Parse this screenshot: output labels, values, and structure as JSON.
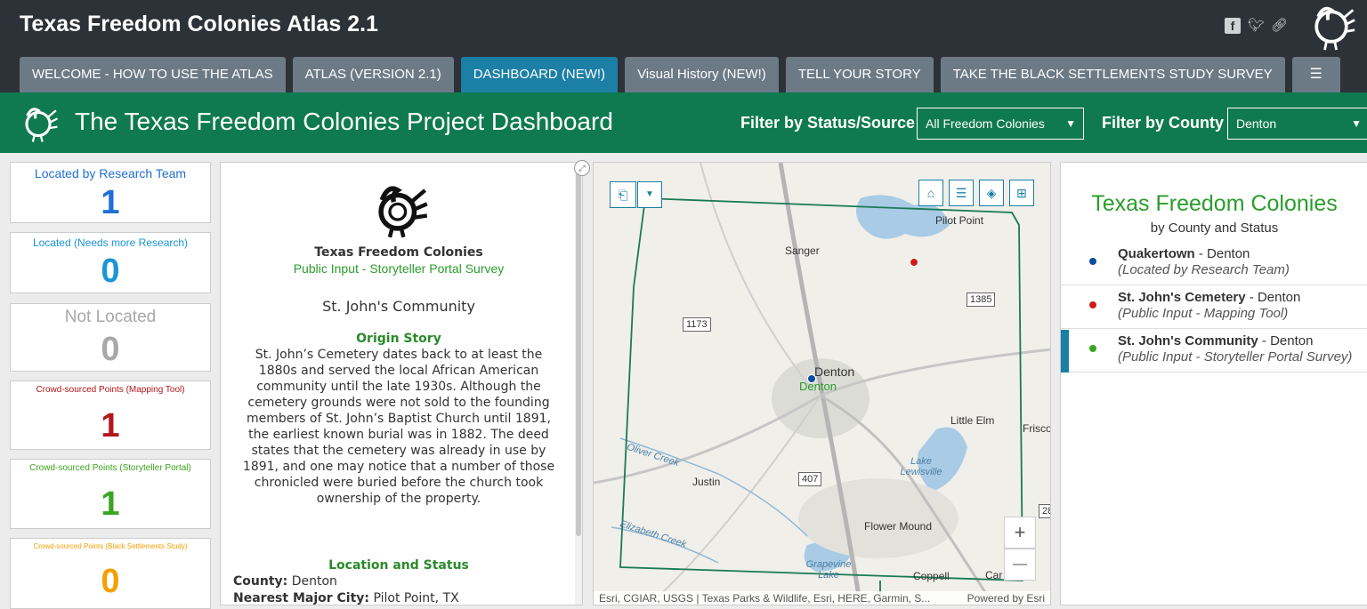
{
  "app": {
    "title": "Texas Freedom Colonies Atlas 2.1",
    "social_icons": [
      "facebook-icon",
      "twitter-icon",
      "link-icon"
    ]
  },
  "tabs": [
    {
      "label": "WELCOME - HOW TO USE THE ATLAS",
      "active": false
    },
    {
      "label": "ATLAS (VERSION 2.1)",
      "active": false
    },
    {
      "label": "DASHBOARD (NEW!)",
      "active": true
    },
    {
      "label": "Visual History (NEW!)",
      "active": false
    },
    {
      "label": "TELL YOUR STORY",
      "active": false
    },
    {
      "label": "TAKE THE BLACK SETTLEMENTS STUDY SURVEY",
      "active": false
    }
  ],
  "dashboard": {
    "title": "The Texas Freedom Colonies Project Dashboard",
    "filter_status_label": "Filter by Status/Source",
    "filter_status_value": "All Freedom Colonies",
    "filter_county_label": "Filter by County",
    "filter_county_value": "Denton"
  },
  "indicators": [
    {
      "label": "Located by Research Team",
      "value": "1",
      "color": "#1f6fd6"
    },
    {
      "label": "Located (Needs more Research)",
      "value": "0",
      "color": "#1b95d6"
    },
    {
      "label": "Not Located",
      "value": "0",
      "color": "#a8a8a8"
    },
    {
      "label": "Crowd-sourced Points (Mapping Tool)",
      "value": "1",
      "color": "#b3161b"
    },
    {
      "label": "Crowd-sourced Points (Storyteller Portal)",
      "value": "1",
      "color": "#3aa51e"
    },
    {
      "label": "Crowd-sourced Points (Black Settlements Study)",
      "value": "0",
      "color": "#f59f00"
    }
  ],
  "survey": {
    "title": "Texas Freedom Colonies",
    "subtitle": "Public Input - Storyteller Portal Survey",
    "community": "St. John's Community",
    "origin_heading": "Origin Story",
    "origin_text": "St. John’s Cemetery dates back to at least the 1880s and served the local African American community until the late 1930s. Although the cemetery grounds were not sold to the founding members of St. John’s Baptist Church until 1891, the earliest known burial was in 1882. The deed states that the cemetery was already in use by 1891, and one may notice that a number of those chronicled were buried before the church took ownership of the property.",
    "location_heading": "Location and Status",
    "county_key": "County:",
    "county_value": "Denton",
    "city_key": "Nearest Major City:",
    "city_value": "Pilot Point, TX"
  },
  "map": {
    "labels": {
      "pilot_point": "Pilot Point",
      "sanger": "Sanger",
      "denton": "Denton",
      "denton_green": "Denton",
      "little_elm": "Little Elm",
      "frisco": "Frisco",
      "justin": "Justin",
      "flower_mound": "Flower Mound",
      "coppell": "Coppell",
      "carrollton": "Car",
      "lake_lewisville": "Lake Lewisville",
      "grapevine_lake": "Grapevine Lake",
      "oliver_creek": "Oliver Creek",
      "elizabeth_creek": "Elizabeth Creek"
    },
    "shields": {
      "s1173": "1173",
      "s1385": "1385",
      "s407": "407",
      "s28": "28"
    },
    "attribution": "Esri, CGIAR, USGS | Texas Parks & Wildlife, Esri, HERE, Garmin, S...",
    "powered": "Powered by Esri",
    "zoom_in": "+",
    "zoom_out": "—"
  },
  "list": {
    "title": "Texas Freedom Colonies",
    "subtitle": "by County and Status",
    "items": [
      {
        "name": "Quakertown",
        "county": " - Denton",
        "status": "(Located by Research Team)",
        "color": "#0c4da2"
      },
      {
        "name": "St. John's Cemetery",
        "county": " - Denton",
        "status": "(Public Input - Mapping Tool)",
        "color": "#d11a1a"
      },
      {
        "name": "St. John's Community",
        "county": " - Denton",
        "status": "(Public Input - Storyteller Portal Survey)",
        "color": "#3aa51e"
      }
    ]
  }
}
